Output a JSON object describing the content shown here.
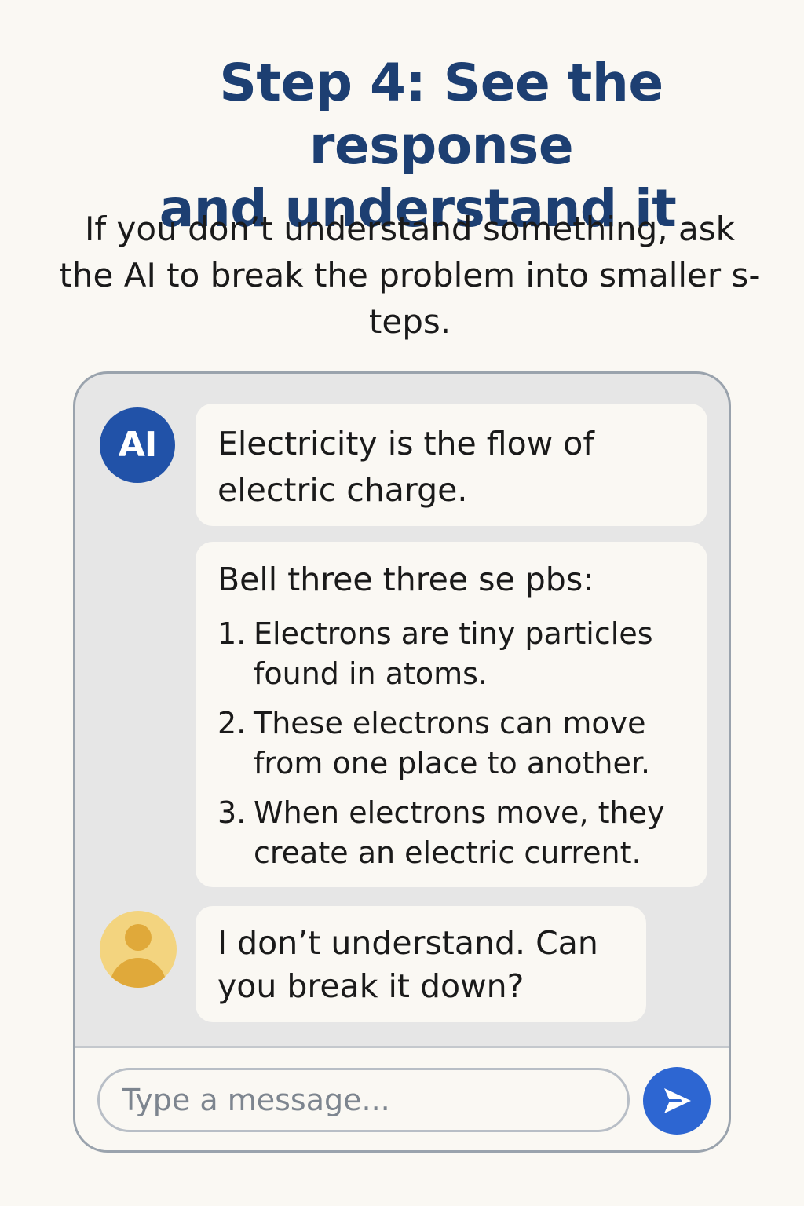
{
  "header": {
    "title_lines": [
      "Step 4: See the response",
      "and understand it"
    ],
    "subtitle_lines": [
      "If you don’t understand something, ask",
      "the AI to break the problem into smaller s-",
      "teps."
    ]
  },
  "chat": {
    "ai_avatar_label": "AI",
    "messages": [
      {
        "sender": "ai",
        "lines": [
          "Electricity is the flow of",
          "electric charge."
        ]
      },
      {
        "sender": "ai",
        "heading": "Bell three three se pbs:",
        "steps": [
          {
            "number": "1.",
            "lines": [
              "Electrons are tiny particles",
              "found in atoms."
            ]
          },
          {
            "number": "2.",
            "lines": [
              "These electrons can move",
              "from one place to another."
            ]
          },
          {
            "number": "3.",
            "lines": [
              "When electrons move, they",
              "create an electric current."
            ]
          }
        ]
      },
      {
        "sender": "user",
        "lines": [
          "I don’t understand. Can",
          "you break it down?"
        ]
      }
    ]
  },
  "composer": {
    "placeholder": "Type a message...",
    "value": ""
  },
  "icons": {
    "ai_avatar": "ai-avatar-icon",
    "user_avatar": "user-avatar-icon",
    "send": "send-icon"
  },
  "colors": {
    "background": "#faf8f3",
    "title": "#1d3f72",
    "chat_background": "#e6e6e6",
    "bubble": "#faf8f3",
    "ai_avatar": "#2152a8",
    "user_avatar": "#f3d47f",
    "send_button": "#2d66d2"
  }
}
